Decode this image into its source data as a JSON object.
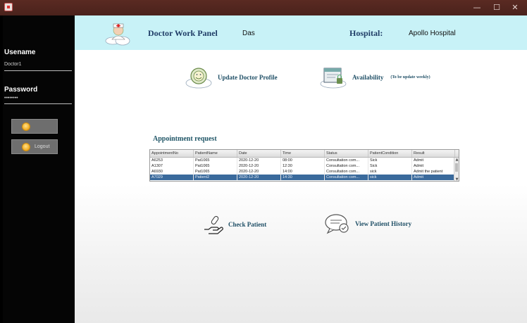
{
  "window": {
    "minimize": "—",
    "maximize": "☐",
    "close": "✕"
  },
  "sidebar": {
    "username_label": "Usename",
    "username_value": "Doctor1",
    "password_label": "Password",
    "password_value": "••••••••",
    "button1_label": "",
    "button2_label": "Logout"
  },
  "header": {
    "title": "Doctor Work Panel",
    "doctor_name": "Das",
    "hospital_label": "Hospital:",
    "hospital_name": "Apollo Hospital"
  },
  "actions": {
    "update_profile": "Update Doctor Profile",
    "availability": "Availability",
    "availability_note": "(To be update weekly)",
    "check_patient": "Check Patient",
    "view_history": "View Patient History"
  },
  "appointments": {
    "title": "Appointment request",
    "columns": [
      "AppointmentNo",
      "PatientName",
      "Date",
      "Time",
      "Status",
      "PatientCondition",
      "Result"
    ],
    "rows": [
      [
        "A6253",
        "Pat1065",
        "2020-12-20",
        "08:00",
        "Consultation com...",
        "Sick",
        "Admit"
      ],
      [
        "A1307",
        "Pat1065",
        "2020-12-20",
        "12:30",
        "Consultation com...",
        "Sick",
        "Admit"
      ],
      [
        "A6930",
        "Pat1065",
        "2020-12-20",
        "14:00",
        "Consultation com...",
        "sick",
        "Admit the patient"
      ],
      [
        "A7029",
        "Patient2",
        "2020-12-20",
        "14:30",
        "Consultation com...",
        "sick",
        "Admit"
      ]
    ],
    "selected_row": 3
  }
}
